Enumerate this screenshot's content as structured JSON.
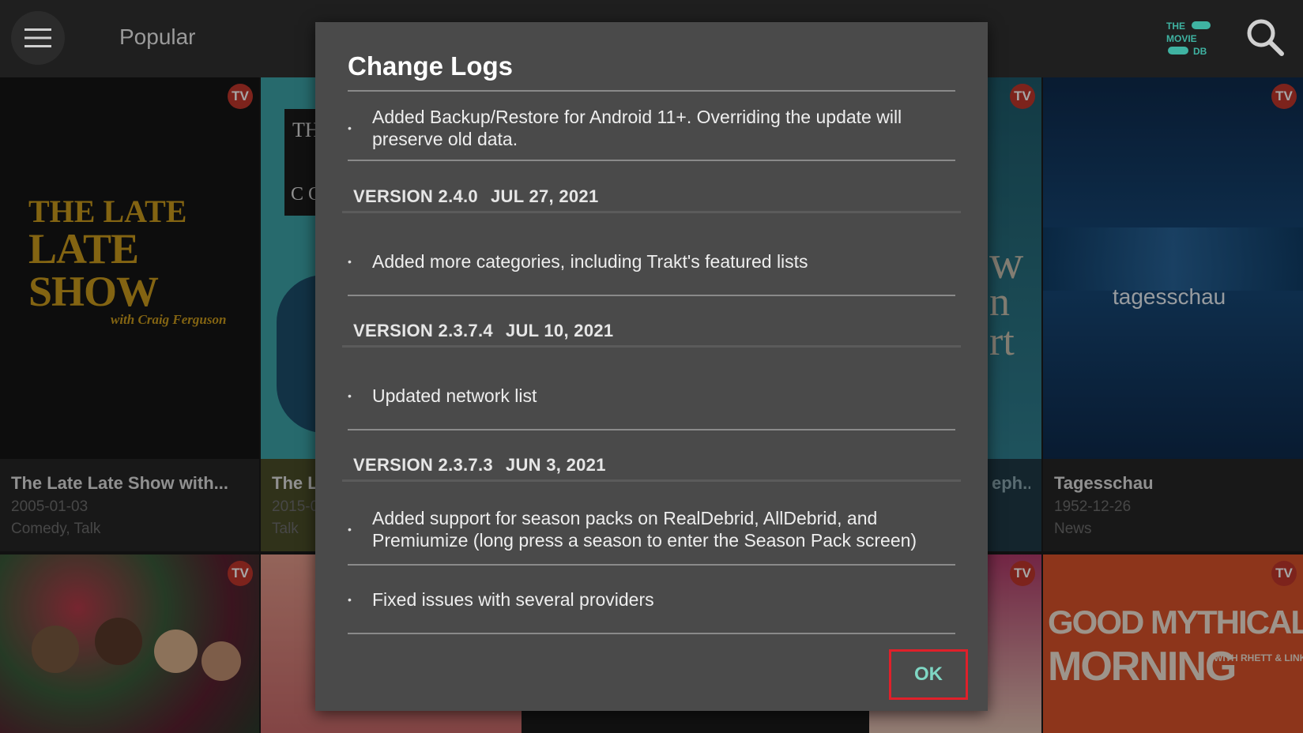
{
  "header": {
    "title": "Popular",
    "logo_lines": [
      "THE",
      "MOVIE",
      "DB"
    ]
  },
  "cards": [
    {
      "title": "The Late Late Show with...",
      "date": "2005-01-03",
      "genre": "Comedy, Talk",
      "badge": "TV",
      "poster_text": [
        "THE LATE",
        "LATE SHOW",
        "with Craig Ferguson"
      ]
    },
    {
      "title": "The L",
      "date": "2015-0",
      "genre": "Talk",
      "badge": "",
      "poster_text": [
        "TH",
        "C O"
      ]
    },
    {
      "title": "eph...",
      "date": "",
      "genre": "",
      "badge": "TV",
      "poster_text": [
        "w",
        "n",
        "rt"
      ]
    },
    {
      "title": "Tagesschau",
      "date": "1952-12-26",
      "genre": "News",
      "badge": "TV",
      "poster_text": [
        "tagesschau"
      ]
    },
    {
      "title": "",
      "date": "",
      "genre": "",
      "badge": "TV",
      "poster_text": []
    },
    {
      "title": "",
      "date": "",
      "genre": "",
      "badge": "TV",
      "poster_text": []
    },
    {
      "title": "",
      "date": "",
      "genre": "",
      "badge": "TV",
      "poster_text": [
        "GOOD MYTHICAL",
        "MORNING",
        "WITH RHETT & LINK"
      ]
    }
  ],
  "dialog": {
    "title": "Change Logs",
    "first_entry": "Added Backup/Restore for Android 11+. Overriding the update will preserve old data.",
    "versions": [
      {
        "version": "VERSION 2.4.0",
        "date": "JUL 27, 2021",
        "entries": [
          "Added more categories, including Trakt's featured lists"
        ]
      },
      {
        "version": "VERSION 2.3.7.4",
        "date": "JUL 10, 2021",
        "entries": [
          "Updated network list"
        ]
      },
      {
        "version": "VERSION 2.3.7.3",
        "date": "JUN 3, 2021",
        "entries": [
          "Added support for season packs on RealDebrid, AllDebrid, and Premiumize (long press a season to enter the Season Pack screen)",
          "Fixed issues with several providers"
        ]
      }
    ],
    "bullet": "•",
    "ok_label": "OK"
  },
  "colors": {
    "accent": "#7fd7c4",
    "focus": "#e0202a",
    "badge": "#c0362c",
    "dialog_bg": "#4a4a4a"
  }
}
